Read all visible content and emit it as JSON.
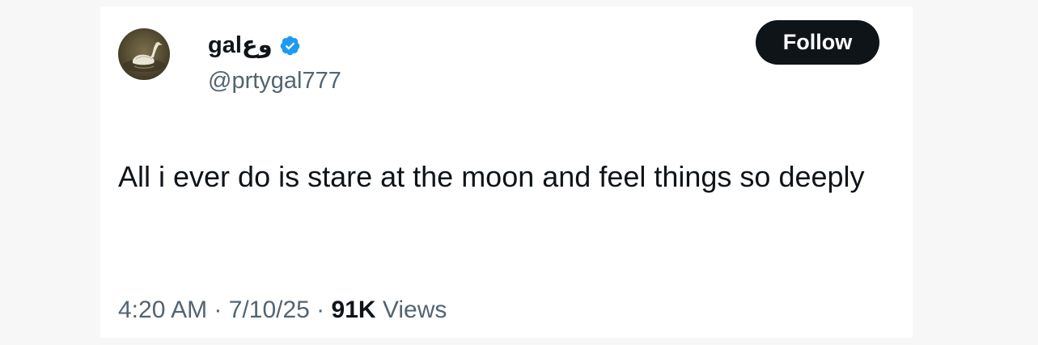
{
  "user": {
    "display_name": "galوع",
    "verified": true,
    "handle": "@prtygal777",
    "avatar_icon": "swan-avatar-icon"
  },
  "actions": {
    "follow_label": "Follow"
  },
  "tweet": {
    "text": "All i ever do is stare at the moon and feel things so deeply"
  },
  "meta": {
    "time": "4:20 AM",
    "separator": " · ",
    "date": "7/10/25",
    "views_count": "91K",
    "views_label": "Views"
  },
  "colors": {
    "text_primary": "#0f1419",
    "text_secondary": "#536471",
    "verified_blue": "#1d9bf0",
    "button_bg": "#0f1419"
  }
}
